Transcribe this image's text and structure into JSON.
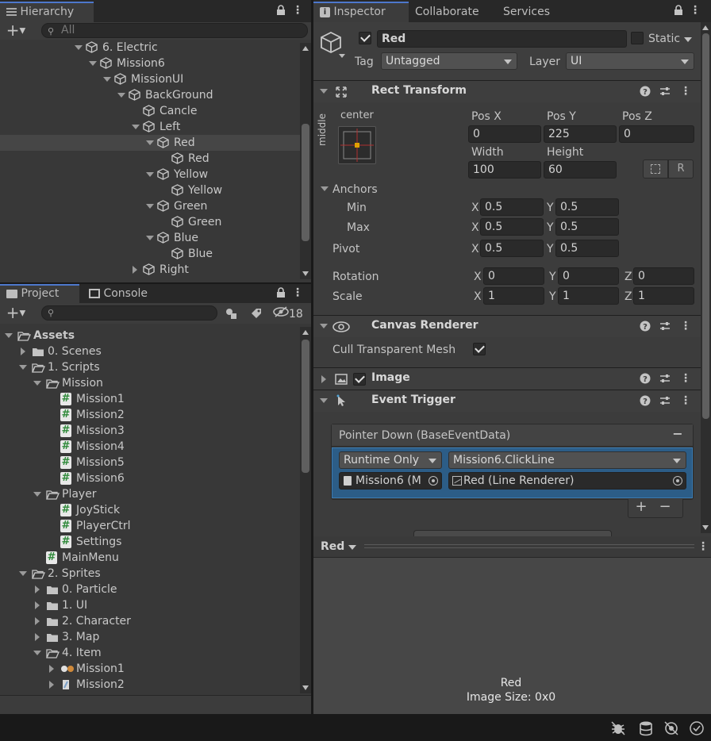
{
  "hierarchy": {
    "tab_label": "Hierarchy",
    "search_placeholder": "All",
    "items": [
      {
        "label": "6. Electric",
        "depth": 0,
        "expanded": true
      },
      {
        "label": "Mission6",
        "depth": 1,
        "expanded": true
      },
      {
        "label": "MissionUI",
        "depth": 2,
        "expanded": true
      },
      {
        "label": "BackGround",
        "depth": 3,
        "expanded": true
      },
      {
        "label": "Cancle",
        "depth": 4,
        "expanded": null
      },
      {
        "label": "Left",
        "depth": 4,
        "expanded": true
      },
      {
        "label": "Red",
        "depth": 5,
        "expanded": true,
        "selected": true
      },
      {
        "label": "Red",
        "depth": 6,
        "expanded": null
      },
      {
        "label": "Yellow",
        "depth": 5,
        "expanded": true
      },
      {
        "label": "Yellow",
        "depth": 6,
        "expanded": null
      },
      {
        "label": "Green",
        "depth": 5,
        "expanded": true
      },
      {
        "label": "Green",
        "depth": 6,
        "expanded": null
      },
      {
        "label": "Blue",
        "depth": 5,
        "expanded": true
      },
      {
        "label": "Blue",
        "depth": 6,
        "expanded": null
      },
      {
        "label": "Right",
        "depth": 4,
        "expanded": false
      }
    ]
  },
  "project": {
    "tab_project": "Project",
    "tab_console": "Console",
    "hidden_count": "18",
    "items": [
      {
        "label": "Assets",
        "depth": 0,
        "kind": "folder",
        "expanded": true,
        "bold": true
      },
      {
        "label": "0. Scenes",
        "depth": 1,
        "kind": "folder",
        "expanded": false
      },
      {
        "label": "1. Scripts",
        "depth": 1,
        "kind": "folder",
        "expanded": true
      },
      {
        "label": "Mission",
        "depth": 2,
        "kind": "folder",
        "expanded": true
      },
      {
        "label": "Mission1",
        "depth": 3,
        "kind": "script"
      },
      {
        "label": "Mission2",
        "depth": 3,
        "kind": "script"
      },
      {
        "label": "Mission3",
        "depth": 3,
        "kind": "script"
      },
      {
        "label": "Mission4",
        "depth": 3,
        "kind": "script"
      },
      {
        "label": "Mission5",
        "depth": 3,
        "kind": "script"
      },
      {
        "label": "Mission6",
        "depth": 3,
        "kind": "script"
      },
      {
        "label": "Player",
        "depth": 2,
        "kind": "folder",
        "expanded": true
      },
      {
        "label": "JoyStick",
        "depth": 3,
        "kind": "script"
      },
      {
        "label": "PlayerCtrl",
        "depth": 3,
        "kind": "script"
      },
      {
        "label": "Settings",
        "depth": 3,
        "kind": "script"
      },
      {
        "label": "MainMenu",
        "depth": 2,
        "kind": "script"
      },
      {
        "label": "2. Sprites",
        "depth": 1,
        "kind": "folder",
        "expanded": true
      },
      {
        "label": "0. Particle",
        "depth": 2,
        "kind": "folder",
        "expanded": false
      },
      {
        "label": "1. UI",
        "depth": 2,
        "kind": "folder",
        "expanded": false
      },
      {
        "label": "2. Character",
        "depth": 2,
        "kind": "folder",
        "expanded": false
      },
      {
        "label": "3. Map",
        "depth": 2,
        "kind": "folder",
        "expanded": false
      },
      {
        "label": "4. Item",
        "depth": 2,
        "kind": "folder",
        "expanded": true
      },
      {
        "label": "Mission1",
        "depth": 3,
        "kind": "sprite",
        "expanded": false
      },
      {
        "label": "Mission2",
        "depth": 3,
        "kind": "sprite",
        "expanded": false
      }
    ]
  },
  "inspector": {
    "tabs": [
      "Inspector",
      "Collaborate",
      "Services"
    ],
    "object_name": "Red",
    "active": true,
    "static_label": "Static",
    "tag_label": "Tag",
    "tag_value": "Untagged",
    "layer_label": "Layer",
    "layer_value": "UI",
    "rect_transform": {
      "title": "Rect Transform",
      "anchor_preset_top": "center",
      "anchor_preset_side": "middle",
      "pos_x_label": "Pos X",
      "pos_x": "0",
      "pos_y_label": "Pos Y",
      "pos_y": "225",
      "pos_z_label": "Pos Z",
      "pos_z": "0",
      "width_label": "Width",
      "width": "100",
      "height_label": "Height",
      "height": "60",
      "anchors_label": "Anchors",
      "min_label": "Min",
      "min_x": "0.5",
      "min_y": "0.5",
      "max_label": "Max",
      "max_x": "0.5",
      "max_y": "0.5",
      "pivot_label": "Pivot",
      "pivot_x": "0.5",
      "pivot_y": "0.5",
      "rotation_label": "Rotation",
      "rot_x": "0",
      "rot_y": "0",
      "rot_z": "0",
      "scale_label": "Scale",
      "scale_x": "1",
      "scale_y": "1",
      "scale_z": "1",
      "x": "X",
      "y": "Y",
      "z": "Z",
      "raw_button": "R"
    },
    "canvas_renderer": {
      "title": "Canvas Renderer",
      "cull_label": "Cull Transparent Mesh",
      "cull_checked": true
    },
    "image": {
      "title": "Image",
      "enabled": true
    },
    "event_trigger": {
      "title": "Event Trigger",
      "event_header": "Pointer Down (BaseEventData)",
      "runtime": "Runtime Only",
      "function": "Mission6.ClickLine",
      "target": "Mission6 (M",
      "argument": "Red (Line Renderer)",
      "remove_glyph": "−",
      "add_glyph": "+"
    }
  },
  "preview": {
    "title": "Red",
    "name": "Red",
    "size_text": "Image Size: 0x0"
  },
  "colors": {
    "accent": "#4d78cc",
    "selection": "#2c5d87",
    "panel": "#383838",
    "field": "#2a2a2a"
  }
}
